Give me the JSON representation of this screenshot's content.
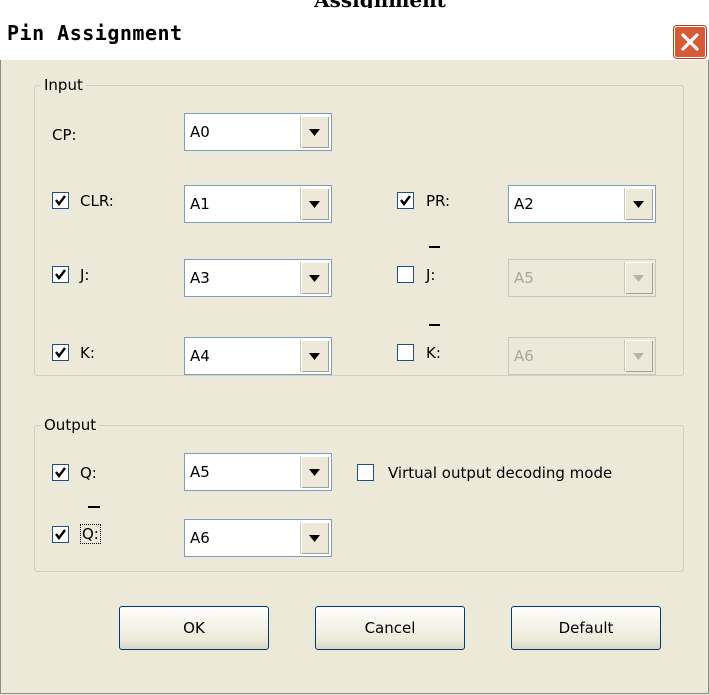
{
  "header_fragment": "Assignment",
  "dialog": {
    "title": "Pin Assignment"
  },
  "input_group": {
    "legend": "Input",
    "cp": {
      "label": "CP:",
      "value": "A0"
    },
    "clr": {
      "label": "CLR:",
      "checked": true,
      "value": "A1"
    },
    "pr": {
      "label": "PR:",
      "checked": true,
      "value": "A2"
    },
    "j": {
      "label": "J:",
      "checked": true,
      "value": "A3"
    },
    "j_bar": {
      "label": "J:",
      "checked": false,
      "value": "A5",
      "enabled": false
    },
    "k": {
      "label": "K:",
      "checked": true,
      "value": "A4"
    },
    "k_bar": {
      "label": "K:",
      "checked": false,
      "value": "A6",
      "enabled": false
    }
  },
  "output_group": {
    "legend": "Output",
    "q": {
      "label": "Q:",
      "checked": true,
      "value": "A5"
    },
    "q_bar": {
      "label": "Q:",
      "checked": true,
      "value": "A6"
    },
    "virtual_mode": {
      "label": "Virtual output decoding mode",
      "checked": false
    }
  },
  "buttons": {
    "ok": "OK",
    "cancel": "Cancel",
    "default": "Default"
  },
  "colors": {
    "dialog_bg": "#ece9d8",
    "close_button": "#d75a36",
    "button_border": "#003c74"
  }
}
